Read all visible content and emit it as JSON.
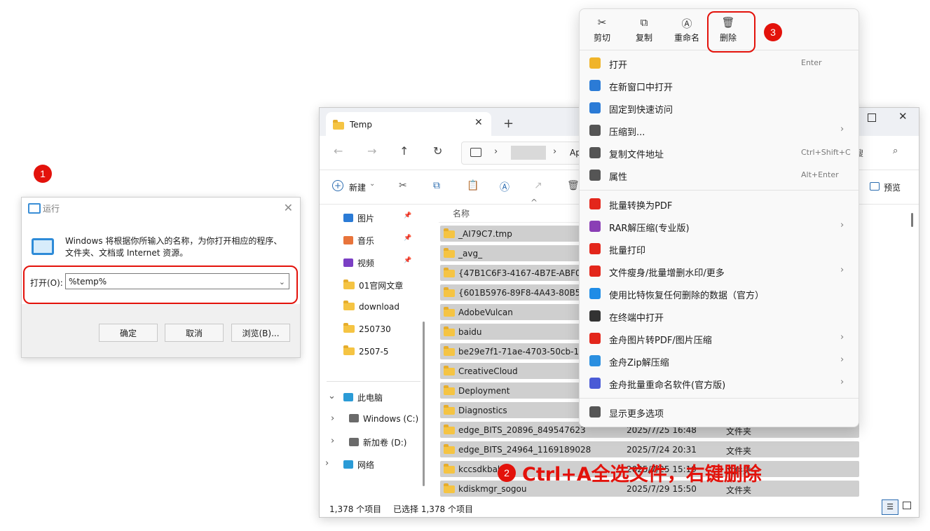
{
  "steps": {
    "one": "1",
    "two": "2",
    "three": "3"
  },
  "annotation": "Ctrl+A全选文件，右键删除",
  "run_dialog": {
    "title": "运行",
    "description": "Windows 将根据你所输入的名称，为你打开相应的程序、文件夹、文档或 Internet 资源。",
    "open_label": "打开(O):",
    "input_value": "%temp%",
    "ok": "确定",
    "cancel": "取消",
    "browse": "浏览(B)..."
  },
  "explorer": {
    "tab_title": "Temp",
    "address_tail": "Ap",
    "search_hint": "搜",
    "new_label": "新建",
    "preview_label": "预览",
    "sidebar": [
      {
        "label": "图片",
        "icon": "pictures-icon"
      },
      {
        "label": "音乐",
        "icon": "music-icon"
      },
      {
        "label": "视频",
        "icon": "video-icon"
      },
      {
        "label": "01官网文章",
        "icon": "folder-icon"
      },
      {
        "label": "download",
        "icon": "folder-icon"
      },
      {
        "label": "250730",
        "icon": "folder-icon"
      },
      {
        "label": "2507-5",
        "icon": "folder-icon"
      },
      {
        "label": "此电脑",
        "icon": "pc-icon"
      },
      {
        "label": "Windows (C:)",
        "icon": "drive-icon"
      },
      {
        "label": "新加卷 (D:)",
        "icon": "drive-icon"
      },
      {
        "label": "网络",
        "icon": "network-icon"
      }
    ],
    "column_name": "名称",
    "files": [
      {
        "name": "_AI79C7.tmp",
        "date": "",
        "type": ""
      },
      {
        "name": "_avg_",
        "date": "",
        "type": ""
      },
      {
        "name": "{47B1C6F3-4167-4B7E-ABF0-2",
        "date": "",
        "type": ""
      },
      {
        "name": "{601B5976-89F8-4A43-80B5-5",
        "date": "",
        "type": ""
      },
      {
        "name": "AdobeVulcan",
        "date": "",
        "type": ""
      },
      {
        "name": "baidu",
        "date": "",
        "type": ""
      },
      {
        "name": "be29e7f1-71ae-4703-50cb-1d",
        "date": "",
        "type": ""
      },
      {
        "name": "CreativeCloud",
        "date": "",
        "type": ""
      },
      {
        "name": "Deployment",
        "date": "",
        "type": ""
      },
      {
        "name": "Diagnostics",
        "date": "",
        "type": ""
      },
      {
        "name": "edge_BITS_20896_849547623",
        "date": "2025/7/25 16:48",
        "type": "文件夹"
      },
      {
        "name": "edge_BITS_24964_1169189028",
        "date": "2025/7/24 20:31",
        "type": "文件夹"
      },
      {
        "name": "kccsdkbak",
        "date": "2025/7/25 15:19",
        "type": "文件夹"
      },
      {
        "name": "kdiskmgr_sogou",
        "date": "2025/7/29 15:50",
        "type": "文件夹"
      }
    ],
    "status_count": "1,378 个项目",
    "status_selected": "已选择 1,378 个项目"
  },
  "context_menu": {
    "top_actions": [
      {
        "label": "剪切",
        "icon": "scissors-icon"
      },
      {
        "label": "复制",
        "icon": "copy-icon"
      },
      {
        "label": "重命名",
        "icon": "rename-icon"
      },
      {
        "label": "删除",
        "icon": "trash-icon"
      }
    ],
    "items": [
      {
        "label": "打开",
        "shortcut": "Enter",
        "arrow": false,
        "icon": "folder-open-icon",
        "color": "#f0b429"
      },
      {
        "label": "在新窗口中打开",
        "shortcut": "",
        "arrow": false,
        "icon": "new-window-icon",
        "color": "#2b7bd6"
      },
      {
        "label": "固定到快速访问",
        "shortcut": "",
        "arrow": false,
        "icon": "pin-icon",
        "color": "#2b7bd6"
      },
      {
        "label": "压缩到...",
        "shortcut": "",
        "arrow": true,
        "icon": "zip-icon",
        "color": "#555555"
      },
      {
        "label": "复制文件地址",
        "shortcut": "Ctrl+Shift+C",
        "arrow": false,
        "icon": "copy-path-icon",
        "color": "#555555"
      },
      {
        "label": "属性",
        "shortcut": "Alt+Enter",
        "arrow": false,
        "icon": "wrench-icon",
        "color": "#555555"
      },
      {
        "label": "批量转换为PDF",
        "shortcut": "",
        "arrow": false,
        "icon": "pdf-icon",
        "color": "#e3261b",
        "sepBefore": true
      },
      {
        "label": "RAR解压缩(专业版)",
        "shortcut": "",
        "arrow": true,
        "icon": "rar-icon",
        "color": "#8a3fb5"
      },
      {
        "label": "批量打印",
        "shortcut": "",
        "arrow": false,
        "icon": "wps-print-icon",
        "color": "#e3261b"
      },
      {
        "label": "文件瘦身/批量增删水印/更多",
        "shortcut": "",
        "arrow": true,
        "icon": "wps-icon",
        "color": "#e3261b"
      },
      {
        "label": "使用比特恢复任何删除的数据（官方）",
        "shortcut": "",
        "arrow": false,
        "icon": "recover-icon",
        "color": "#1f8ce6"
      },
      {
        "label": "在终端中打开",
        "shortcut": "",
        "arrow": false,
        "icon": "terminal-icon",
        "color": "#333333"
      },
      {
        "label": "金舟图片转PDF/图片压缩",
        "shortcut": "",
        "arrow": true,
        "icon": "jz-pdf-icon",
        "color": "#e3261b"
      },
      {
        "label": "金舟Zip解压缩",
        "shortcut": "",
        "arrow": true,
        "icon": "jz-zip-icon",
        "color": "#2b8fe0"
      },
      {
        "label": "金舟批量重命名软件(官方版)",
        "shortcut": "",
        "arrow": true,
        "icon": "jz-rename-icon",
        "color": "#4a5bd6"
      },
      {
        "label": "显示更多选项",
        "shortcut": "",
        "arrow": false,
        "icon": "more-options-icon",
        "color": "#555555",
        "sepBefore": true
      }
    ]
  }
}
